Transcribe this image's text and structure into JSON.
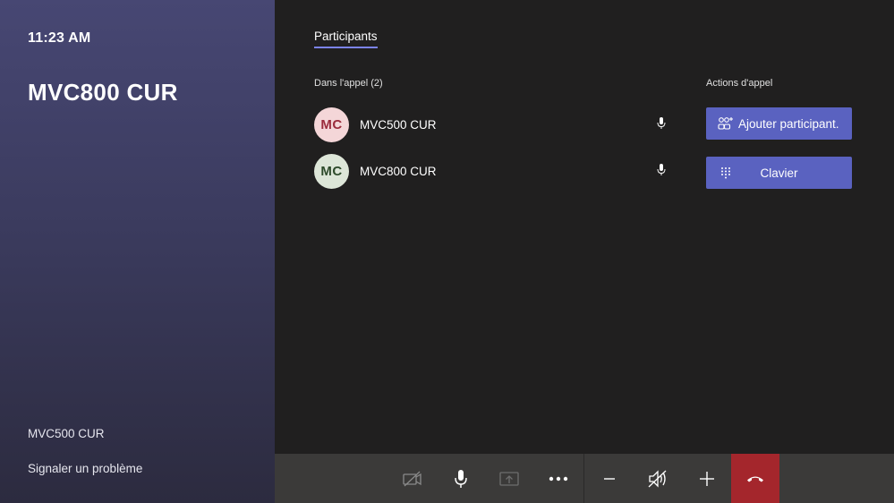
{
  "left_panel": {
    "time": "11:23 AM",
    "call_name": "MVC800 CUR",
    "footer_name": "MVC500 CUR",
    "report_link": "Signaler un problème"
  },
  "main": {
    "tab_label": "Participants",
    "in_call_label": "Dans l'appel (2)",
    "actions_label": "Actions d'appel",
    "participants": [
      {
        "initials": "MC",
        "name": "MVC500 CUR",
        "avatar_bg": "#f4d6d8",
        "avatar_fg": "#9b2c3c"
      },
      {
        "initials": "MC",
        "name": "MVC800 CUR",
        "avatar_bg": "#dde6d8",
        "avatar_fg": "#2d4a2a"
      }
    ],
    "actions": {
      "add_participant": "Ajouter participant.",
      "keypad": "Clavier"
    }
  },
  "bottom_bar": {
    "icons": [
      "video-off-icon",
      "mic-icon",
      "share-screen-icon",
      "more-icon",
      "volume-down-icon",
      "speaker-mute-icon",
      "volume-up-icon",
      "hang-up-icon"
    ],
    "hangup_color": "#a4262c"
  },
  "colors": {
    "accent": "#5a62c0",
    "tab_underline": "#7b83eb",
    "background": "#201f1f",
    "bottom_bar": "#3b3a39"
  }
}
